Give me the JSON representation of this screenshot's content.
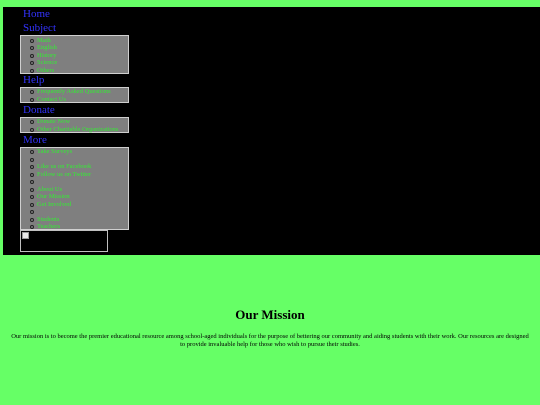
{
  "colors": {
    "page_background": "#66ff66",
    "nav_background": "#000000",
    "heading_color": "#3333ff",
    "link_box_background": "#7f7f7f",
    "link_color": "#33ee33"
  },
  "nav": {
    "home": {
      "label": "Home"
    },
    "subject": {
      "label": "Subject",
      "items": [
        {
          "label": "Math"
        },
        {
          "label": "English"
        },
        {
          "label": "History"
        },
        {
          "label": "Science"
        },
        {
          "label": "Others"
        }
      ]
    },
    "help": {
      "label": "Help",
      "items": [
        {
          "label": "Frequently Asked Questions"
        },
        {
          "label": "Contact Us"
        }
      ]
    },
    "donate": {
      "label": "Donate",
      "items": [
        {
          "label": "Donate Now"
        },
        {
          "label": "Other Charitable Organizations"
        }
      ]
    },
    "more": {
      "label": "More",
      "items": [
        {
          "label": "Take Surveys"
        },
        {
          "label": ""
        },
        {
          "label": "Like us on Facebook"
        },
        {
          "label": "Follow us on Twitter"
        },
        {
          "label": ""
        },
        {
          "label": "About Us"
        },
        {
          "label": "Our Mission"
        },
        {
          "label": "Get Involved"
        },
        {
          "label": ""
        },
        {
          "label": "Students"
        },
        {
          "label": "Teachers"
        }
      ]
    },
    "footer_image_icon": "broken-image-icon"
  },
  "mission": {
    "title": "Our Mission",
    "text": "Our mission is to become the premier educational resource among school-aged individuals for the purpose of bettering our community and aiding students with their work. Our resources are designed to provide invaluable help for those who wish to pursue their studies."
  }
}
